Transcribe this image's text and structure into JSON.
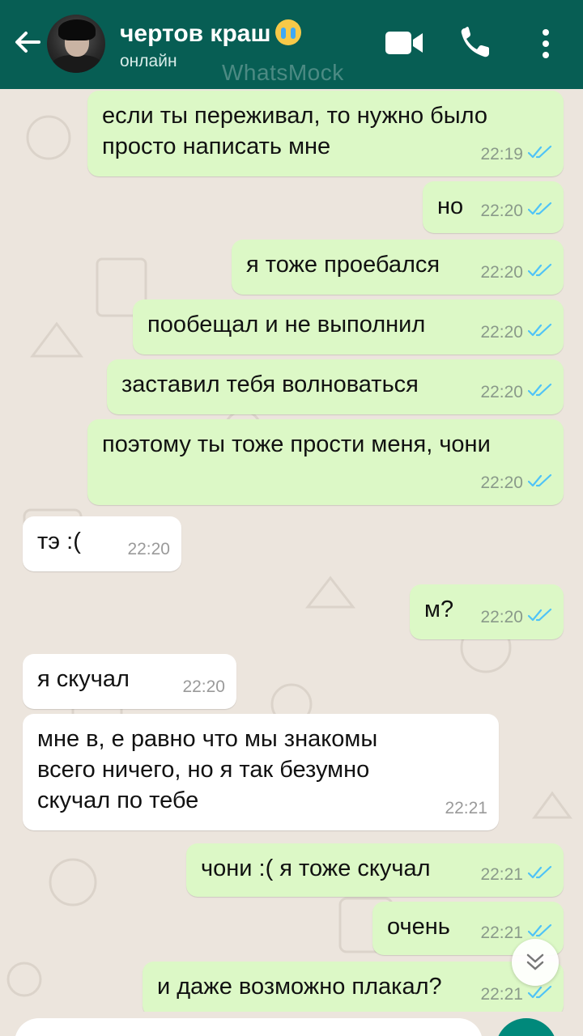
{
  "header": {
    "contact_name": "чертов краш",
    "status": "онлайн",
    "watermark": "WhatsMock",
    "icons": [
      "back-arrow-icon",
      "video-call-icon",
      "voice-call-icon",
      "more-vert-icon"
    ],
    "emoji": "loudly-crying-face"
  },
  "colors": {
    "header": "#075e54",
    "outgoing_bubble": "#dcf8c6",
    "incoming_bubble": "#ffffff",
    "chat_background": "#ece5dd",
    "read_ticks": "#4fc3f7"
  },
  "messages": [
    {
      "dir": "out",
      "text": "если ты переживал, то нужно было\nпросто написать мне",
      "time": "22:19",
      "read": true
    },
    {
      "dir": "out",
      "text": "но",
      "time": "22:20",
      "read": true
    },
    {
      "dir": "out",
      "text": "я тоже проебался",
      "time": "22:20",
      "read": true
    },
    {
      "dir": "out",
      "text": "пообещал и не выполнил",
      "time": "22:20",
      "read": true
    },
    {
      "dir": "out",
      "text": "заставил тебя волноваться",
      "time": "22:20",
      "read": true
    },
    {
      "dir": "out",
      "text": "поэтому ты тоже прости меня, чони",
      "time": "22:20",
      "read": true
    },
    {
      "dir": "in",
      "text": "тэ :(",
      "time": "22:20"
    },
    {
      "dir": "out",
      "text": "м?",
      "time": "22:20",
      "read": true
    },
    {
      "dir": "in",
      "text": "я скучал",
      "time": "22:20"
    },
    {
      "dir": "in",
      "text": "мне в, е равно что мы знакомы\nвсего ничего, но я так безумно\nскучал по тебе",
      "time": "22:21"
    },
    {
      "dir": "out",
      "text": "чони :( я тоже скучал",
      "time": "22:21",
      "read": true
    },
    {
      "dir": "out",
      "text": "очень",
      "time": "22:21",
      "read": true
    },
    {
      "dir": "out",
      "text": "и даже возможно плакал?",
      "time": "22:21",
      "read": true
    }
  ],
  "input": {
    "placeholder": ""
  }
}
